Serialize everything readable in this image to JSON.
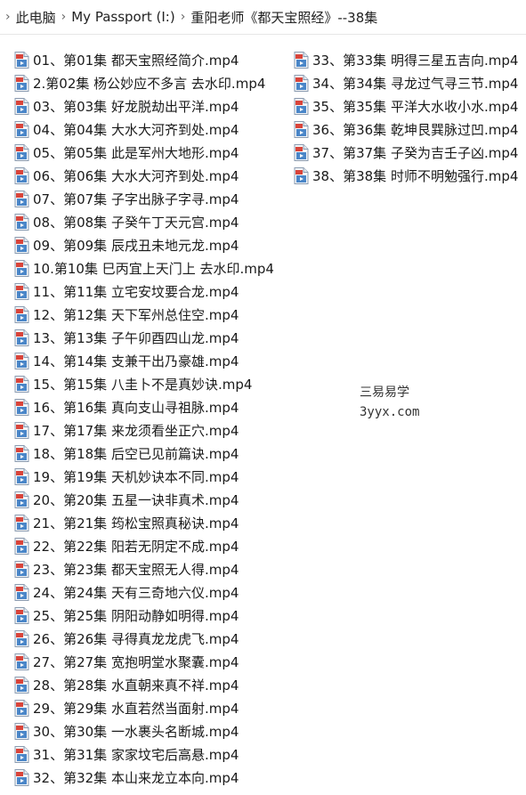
{
  "breadcrumb": {
    "start_icon": "chevron-right-icon",
    "parts": [
      "此电脑",
      "My Passport (I:)",
      "重阳老师《都天宝照经》--38集"
    ]
  },
  "watermark": {
    "line1": "三易易学",
    "line2": "3yyx.com"
  },
  "files_left": [
    "01、第01集 都天宝照经简介.mp4",
    "2.第02集 杨公妙应不多言 去水印.mp4",
    "03、第03集 好龙脱劫出平洋.mp4",
    "04、第04集 大水大河齐到处.mp4",
    "05、第05集 此是军州大地形.mp4",
    "06、第06集 大水大河齐到处.mp4",
    "07、第07集 子字出脉子字寻.mp4",
    "08、第08集 子癸午丁天元宫.mp4",
    "09、第09集 辰戌丑未地元龙.mp4",
    "10.第10集 巳丙宜上天门上 去水印.mp4",
    "11、第11集 立宅安坟要合龙.mp4",
    "12、第12集 天下军州总住空.mp4",
    "13、第13集 子午卯酉四山龙.mp4",
    "14、第14集 支兼干出乃豪雄.mp4",
    "15、第15集 八圭卜不是真妙诀.mp4",
    "16、第16集 真向支山寻祖脉.mp4",
    "17、第17集 来龙须看坐正穴.mp4",
    "18、第18集 后空已见前篇诀.mp4",
    "19、第19集 天机妙诀本不同.mp4",
    "20、第20集 五星一诀非真术.mp4",
    "21、第21集 筠松宝照真秘诀.mp4",
    "22、第22集 阳若无阴定不成.mp4",
    "23、第23集 都天宝照无人得.mp4",
    "24、第24集 天有三奇地六仪.mp4",
    "25、第25集 阴阳动静如明得.mp4",
    "26、第26集 寻得真龙龙虎飞.mp4",
    "27、第27集 宽抱明堂水聚囊.mp4",
    "28、第28集 水直朝来真不祥.mp4",
    "29、第29集 水直若然当面射.mp4",
    "30、第30集 一水裹头名断城.mp4",
    "31、第31集 家家坟宅后高悬.mp4",
    "32、第32集 本山来龙立本向.mp4"
  ],
  "files_right": [
    "33、第33集 明得三星五吉向.mp4",
    "34、第34集 寻龙过气寻三节.mp4",
    "35、第35集 平洋大水收小水.mp4",
    "36、第36集 乾坤艮巽脉过凹.mp4",
    "37、第37集 子癸为吉壬子凶.mp4",
    "38、第38集 时师不明勉强行.mp4"
  ],
  "file_icon": "video-file-icon",
  "colors": {
    "icon_blue": "#4a86c8",
    "icon_red": "#d9443a"
  }
}
